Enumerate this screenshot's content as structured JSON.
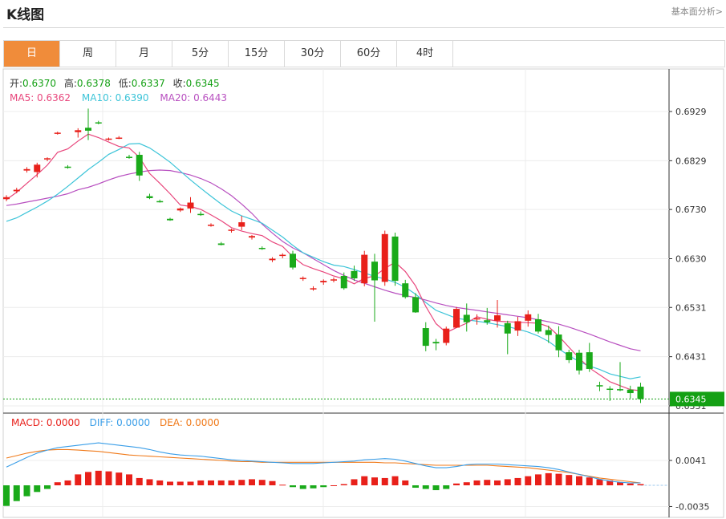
{
  "header": {
    "title": "K线图",
    "link": "基本面分析>"
  },
  "tabs": [
    "日",
    "周",
    "月",
    "5分",
    "15分",
    "30分",
    "60分",
    "4时"
  ],
  "active_tab": 0,
  "ohlc_labels": {
    "open": "开:",
    "open_val": "0.6370",
    "high": "高:",
    "high_val": "0.6378",
    "low": "低:",
    "low_val": "0.6337",
    "close": "收:",
    "close_val": "0.6345"
  },
  "ma_labels": {
    "ma5": "MA5: 0.6362",
    "ma10": "MA10: 0.6390",
    "ma20": "MA20: 0.6443"
  },
  "macd_labels": {
    "macd": "MACD: 0.0000",
    "diff": "DIFF: 0.0000",
    "dea": "DEA: 0.0000"
  },
  "colors": {
    "up": "#e8201a",
    "down": "#1aaa1a",
    "ma5": "#e8467c",
    "ma10": "#3cc4d8",
    "ma20": "#b850c0",
    "diff": "#3a9ee8",
    "dea": "#f07a1a",
    "current": "#14a014"
  },
  "chart_data": [
    {
      "type": "candlestick",
      "title": "",
      "ylim": [
        0.6331,
        0.6969
      ],
      "yticks": [
        "0.6929",
        "0.6829",
        "0.6730",
        "0.6630",
        "0.6531",
        "0.6431",
        "0.6331"
      ],
      "current_price": "0.6345",
      "candles": [
        [
          0.6751,
          0.6759,
          0.6747,
          0.6755
        ],
        [
          0.6767,
          0.6774,
          0.6763,
          0.677
        ],
        [
          0.6809,
          0.6816,
          0.6805,
          0.6812
        ],
        [
          0.6806,
          0.6825,
          0.6795,
          0.6821
        ],
        [
          0.6832,
          0.6836,
          0.6828,
          0.6834
        ],
        [
          0.6885,
          0.6888,
          0.6882,
          0.6886
        ],
        [
          0.6817,
          0.682,
          0.6813,
          0.6815
        ],
        [
          0.6887,
          0.6895,
          0.6876,
          0.6891
        ],
        [
          0.6896,
          0.6935,
          0.6871,
          0.689
        ],
        [
          0.6907,
          0.691,
          0.6903,
          0.6905
        ],
        [
          0.6873,
          0.6876,
          0.687,
          0.6874
        ],
        [
          0.6875,
          0.6879,
          0.6873,
          0.6876
        ],
        [
          0.6837,
          0.6841,
          0.6833,
          0.6835
        ],
        [
          0.6841,
          0.6847,
          0.6788,
          0.6799
        ],
        [
          0.6757,
          0.6762,
          0.6751,
          0.6753
        ],
        [
          0.6747,
          0.675,
          0.6744,
          0.6745
        ],
        [
          0.6711,
          0.6713,
          0.6707,
          0.6708
        ],
        [
          0.6728,
          0.6734,
          0.6725,
          0.6732
        ],
        [
          0.6732,
          0.6755,
          0.6723,
          0.6744
        ],
        [
          0.6721,
          0.6726,
          0.6717,
          0.672
        ],
        [
          0.6698,
          0.6702,
          0.6695,
          0.6699
        ],
        [
          0.6661,
          0.6664,
          0.6657,
          0.6658
        ],
        [
          0.6687,
          0.6691,
          0.6683,
          0.6689
        ],
        [
          0.6695,
          0.6717,
          0.6688,
          0.6704
        ],
        [
          0.6673,
          0.6678,
          0.6669,
          0.6676
        ],
        [
          0.6652,
          0.6655,
          0.6648,
          0.665
        ],
        [
          0.6627,
          0.6633,
          0.6623,
          0.663
        ],
        [
          0.6636,
          0.6641,
          0.6631,
          0.6638
        ],
        [
          0.664,
          0.6646,
          0.6608,
          0.6612
        ],
        [
          0.6589,
          0.6594,
          0.6585,
          0.6591
        ],
        [
          0.6569,
          0.6574,
          0.6565,
          0.657
        ],
        [
          0.6582,
          0.6588,
          0.6577,
          0.6585
        ],
        [
          0.6587,
          0.6592,
          0.6582,
          0.6588
        ],
        [
          0.6595,
          0.6602,
          0.6567,
          0.657
        ],
        [
          0.6605,
          0.6616,
          0.6585,
          0.659
        ],
        [
          0.658,
          0.6646,
          0.6574,
          0.6638
        ],
        [
          0.6624,
          0.664,
          0.6502,
          0.6586
        ],
        [
          0.6583,
          0.6687,
          0.6575,
          0.668
        ],
        [
          0.6675,
          0.6683,
          0.6575,
          0.6585
        ],
        [
          0.658,
          0.6587,
          0.6549,
          0.6552
        ],
        [
          0.6552,
          0.656,
          0.652,
          0.6521
        ],
        [
          0.6489,
          0.6501,
          0.6442,
          0.6453
        ],
        [
          0.6461,
          0.6467,
          0.6444,
          0.6458
        ],
        [
          0.6459,
          0.6492,
          0.6454,
          0.6488
        ],
        [
          0.649,
          0.6532,
          0.6489,
          0.6528
        ],
        [
          0.6516,
          0.6539,
          0.6482,
          0.6501
        ],
        [
          0.6509,
          0.6517,
          0.6496,
          0.6509
        ],
        [
          0.6505,
          0.653,
          0.6496,
          0.6501
        ],
        [
          0.6504,
          0.6546,
          0.649,
          0.6515
        ],
        [
          0.6499,
          0.6504,
          0.6436,
          0.6478
        ],
        [
          0.6484,
          0.6512,
          0.6473,
          0.6503
        ],
        [
          0.6504,
          0.6525,
          0.6492,
          0.6517
        ],
        [
          0.6507,
          0.6518,
          0.6478,
          0.6482
        ],
        [
          0.6485,
          0.6494,
          0.6459,
          0.6475
        ],
        [
          0.6476,
          0.6493,
          0.643,
          0.6444
        ],
        [
          0.644,
          0.6445,
          0.6418,
          0.6424
        ],
        [
          0.6439,
          0.6445,
          0.6395,
          0.6403
        ],
        [
          0.644,
          0.6459,
          0.64,
          0.6406
        ],
        [
          0.6373,
          0.638,
          0.6361,
          0.6371
        ],
        [
          0.6366,
          0.6371,
          0.6341,
          0.6364
        ],
        [
          0.6365,
          0.642,
          0.6361,
          0.6364
        ],
        [
          0.6364,
          0.6372,
          0.6346,
          0.6357
        ],
        [
          0.637,
          0.6378,
          0.6337,
          0.6345
        ]
      ],
      "ma5": [
        0.675,
        0.6765,
        0.6783,
        0.6801,
        0.682,
        0.6846,
        0.6853,
        0.6869,
        0.6883,
        0.6876,
        0.6867,
        0.6858,
        0.6855,
        0.6836,
        0.6803,
        0.6783,
        0.6762,
        0.6739,
        0.6736,
        0.673,
        0.6719,
        0.6707,
        0.6693,
        0.6686,
        0.6681,
        0.6677,
        0.6664,
        0.6655,
        0.6634,
        0.6618,
        0.661,
        0.6603,
        0.6595,
        0.6589,
        0.6579,
        0.659,
        0.6595,
        0.661,
        0.6623,
        0.6604,
        0.6575,
        0.6533,
        0.6498,
        0.648,
        0.649,
        0.6499,
        0.6512,
        0.6507,
        0.6503,
        0.6502,
        0.6501,
        0.65,
        0.6499,
        0.6492,
        0.6473,
        0.645,
        0.6428,
        0.6408,
        0.6394,
        0.638,
        0.6372,
        0.6364,
        0.6362
      ],
      "ma10": [
        0.6706,
        0.6713,
        0.6724,
        0.6735,
        0.6747,
        0.6761,
        0.6777,
        0.6794,
        0.6811,
        0.6826,
        0.6842,
        0.6852,
        0.6863,
        0.6864,
        0.6855,
        0.6841,
        0.6826,
        0.6808,
        0.679,
        0.6773,
        0.6757,
        0.6741,
        0.6727,
        0.6717,
        0.671,
        0.6702,
        0.6688,
        0.6674,
        0.6657,
        0.6642,
        0.6633,
        0.6624,
        0.6617,
        0.6614,
        0.6608,
        0.6601,
        0.6594,
        0.6589,
        0.6582,
        0.6572,
        0.6558,
        0.6541,
        0.6525,
        0.6517,
        0.6509,
        0.6506,
        0.6503,
        0.65,
        0.6496,
        0.6492,
        0.6487,
        0.6481,
        0.6473,
        0.6462,
        0.6447,
        0.6433,
        0.6421,
        0.6412,
        0.6405,
        0.6396,
        0.6391,
        0.6386,
        0.639
      ],
      "ma20": [
        0.6738,
        0.6741,
        0.6745,
        0.6749,
        0.6753,
        0.6757,
        0.6762,
        0.677,
        0.6775,
        0.6782,
        0.679,
        0.6797,
        0.6802,
        0.6806,
        0.6809,
        0.681,
        0.6809,
        0.6805,
        0.68,
        0.6793,
        0.6784,
        0.6772,
        0.6758,
        0.6741,
        0.6722,
        0.67,
        0.6682,
        0.6665,
        0.6652,
        0.6642,
        0.663,
        0.6618,
        0.6606,
        0.6596,
        0.6587,
        0.658,
        0.6573,
        0.6566,
        0.656,
        0.6555,
        0.6551,
        0.6546,
        0.654,
        0.6535,
        0.6531,
        0.6528,
        0.6525,
        0.6522,
        0.6519,
        0.6516,
        0.6513,
        0.651,
        0.6506,
        0.6502,
        0.6497,
        0.6491,
        0.6484,
        0.6477,
        0.6469,
        0.6461,
        0.6454,
        0.6447,
        0.6443
      ]
    },
    {
      "type": "macd",
      "title": "",
      "ylim": [
        -0.0045,
        0.0075
      ],
      "yticks": [
        "0.0041",
        "-0.0035"
      ],
      "diff": [
        0.003,
        0.0038,
        0.0046,
        0.0053,
        0.0058,
        0.0062,
        0.0064,
        0.0066,
        0.0068,
        0.007,
        0.0068,
        0.0066,
        0.0064,
        0.0062,
        0.0059,
        0.0055,
        0.0052,
        0.005,
        0.0049,
        0.0048,
        0.0046,
        0.0044,
        0.0042,
        0.0041,
        0.004,
        0.0039,
        0.0038,
        0.0037,
        0.0036,
        0.0036,
        0.0036,
        0.0037,
        0.0038,
        0.0039,
        0.004,
        0.0042,
        0.0043,
        0.0044,
        0.0043,
        0.004,
        0.0036,
        0.0032,
        0.0029,
        0.0029,
        0.0031,
        0.0034,
        0.0035,
        0.0035,
        0.0035,
        0.0034,
        0.0033,
        0.0032,
        0.0031,
        0.0029,
        0.0026,
        0.0022,
        0.0018,
        0.0014,
        0.001,
        0.0007,
        0.0005,
        0.0004,
        0.0004
      ],
      "dea": [
        0.0045,
        0.0049,
        0.0053,
        0.0056,
        0.0058,
        0.0059,
        0.0059,
        0.0058,
        0.0057,
        0.0056,
        0.0054,
        0.0052,
        0.005,
        0.0049,
        0.0048,
        0.0047,
        0.0046,
        0.0045,
        0.0044,
        0.0043,
        0.0042,
        0.0041,
        0.004,
        0.0039,
        0.0039,
        0.0038,
        0.0038,
        0.0038,
        0.0038,
        0.0038,
        0.0038,
        0.0038,
        0.0038,
        0.0038,
        0.0038,
        0.0038,
        0.0038,
        0.0037,
        0.0037,
        0.0036,
        0.0035,
        0.0034,
        0.0033,
        0.0033,
        0.0033,
        0.0033,
        0.0033,
        0.0033,
        0.0032,
        0.0031,
        0.003,
        0.0029,
        0.0027,
        0.0025,
        0.0023,
        0.0021,
        0.0018,
        0.0015,
        0.0012,
        0.001,
        0.0008,
        0.0006,
        0.0004
      ],
      "hist": [
        -0.0034,
        -0.0026,
        -0.0018,
        -0.0011,
        -0.0006,
        0.0005,
        0.0008,
        0.0018,
        0.0022,
        0.0024,
        0.0023,
        0.0021,
        0.0018,
        0.0012,
        0.001,
        0.0008,
        0.0006,
        0.0006,
        0.0006,
        0.0008,
        0.0008,
        0.0008,
        0.0008,
        0.0009,
        0.001,
        0.0009,
        0.0007,
        0.0001,
        -0.0003,
        -0.0006,
        -0.0005,
        -0.0003,
        0.0,
        0.0002,
        0.001,
        0.0015,
        0.0013,
        0.0012,
        0.0015,
        0.0008,
        -0.0004,
        -0.0006,
        -0.0008,
        -0.0006,
        0.0003,
        0.0005,
        0.0008,
        0.0009,
        0.0008,
        0.001,
        0.0012,
        0.0015,
        0.0018,
        0.002,
        0.0019,
        0.0017,
        0.0015,
        0.0013,
        0.001,
        0.0008,
        0.0005,
        0.0003,
        0.0002
      ]
    }
  ]
}
